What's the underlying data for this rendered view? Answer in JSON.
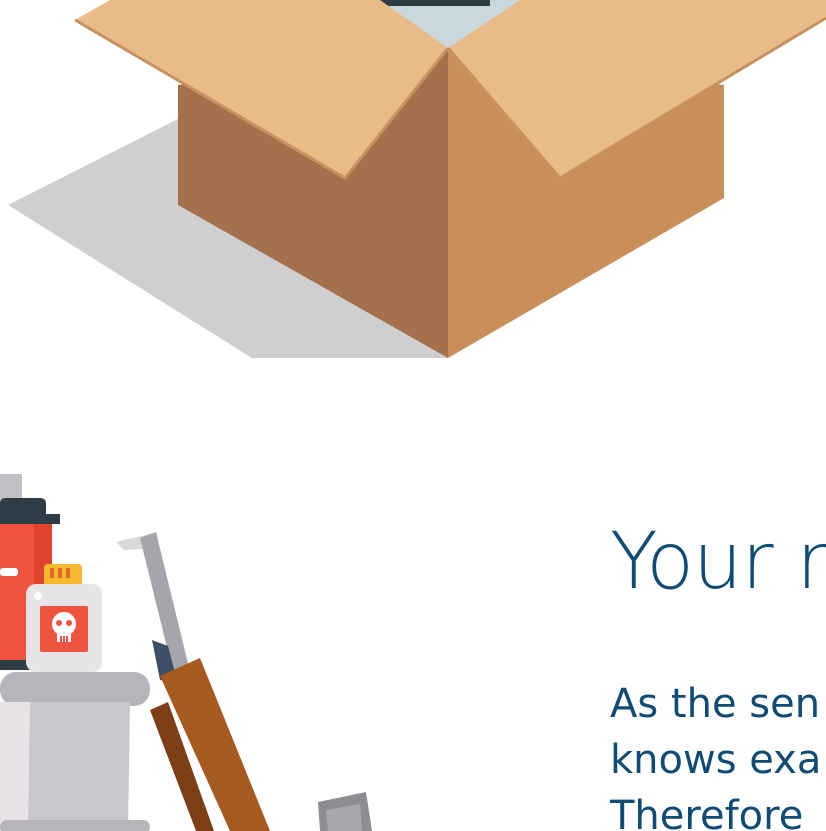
{
  "section": {
    "heading": "Your r",
    "body_lines": [
      "As the sen",
      "knows exa",
      "Therefore"
    ]
  },
  "colors": {
    "heading": "#0f4c75",
    "box_flap_light": "#e9bb89",
    "box_front_dark": "#a5714c",
    "box_front_light": "#c88f5b",
    "shadow": "#cfcfd1",
    "red_canister": "#f0533f",
    "handle_brown": "#a65a1f"
  }
}
